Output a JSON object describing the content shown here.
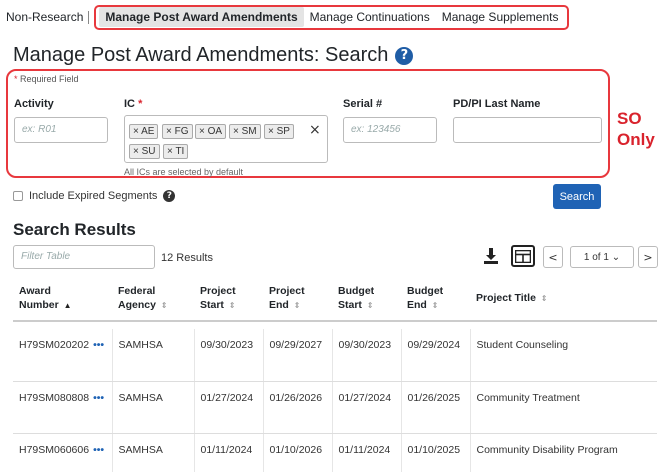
{
  "nav": {
    "non_research": "Non-Research",
    "tabs": [
      {
        "label": "Manage Post Award Amendments",
        "active": true
      },
      {
        "label": "Manage Continuations",
        "active": false
      },
      {
        "label": "Manage Supplements",
        "active": false
      }
    ]
  },
  "page": {
    "title": "Manage Post Award Amendments: Search",
    "help_icon": "?"
  },
  "form": {
    "required_note": "Required Field",
    "required_star": "*",
    "activity": {
      "label": "Activity",
      "placeholder": "ex: R01"
    },
    "ic": {
      "label": "IC",
      "chips": [
        "× AE",
        "× FG",
        "× OA",
        "× SM",
        "× SP",
        "× SU",
        "× TI"
      ],
      "clear": "×",
      "note": "All ICs are selected by default"
    },
    "serial": {
      "label": "Serial #",
      "placeholder": "ex: 123456"
    },
    "pdpi": {
      "label": "PD/PI Last Name",
      "placeholder": ""
    },
    "so_only": [
      "SO",
      "Only"
    ],
    "include_expired": "Include Expired Segments",
    "search_button": "Search"
  },
  "results": {
    "title": "Search Results",
    "filter_placeholder": "Filter Table",
    "count": "12 Results",
    "pagination": {
      "prev": "<",
      "next": ">",
      "page": "1 of 1 ⌄"
    },
    "columns": [
      {
        "line1": "Award",
        "line2": "Number",
        "sort": "▲",
        "active": true
      },
      {
        "line1": "Federal",
        "line2": "Agency",
        "sort": "⇕",
        "active": false
      },
      {
        "line1": "Project",
        "line2": "Start",
        "sort": "⇕",
        "active": false
      },
      {
        "line1": "Project",
        "line2": "End",
        "sort": "⇕",
        "active": false
      },
      {
        "line1": "Budget",
        "line2": "Start",
        "sort": "⇕",
        "active": false
      },
      {
        "line1": "Budget",
        "line2": "End",
        "sort": "⇕",
        "active": false
      },
      {
        "line1": "Project Title",
        "line2": "",
        "sort": "⇕",
        "active": false
      }
    ],
    "rows": [
      {
        "award": "H79SM020202",
        "agency": "SAMHSA",
        "pstart": "09/30/2023",
        "pend": "09/29/2027",
        "bstart": "09/30/2023",
        "bend": "09/29/2024",
        "title": "Student Counseling"
      },
      {
        "award": "H79SM080808",
        "agency": "SAMHSA",
        "pstart": "01/27/2024",
        "pend": "01/26/2026",
        "bstart": "01/27/2024",
        "bend": "01/26/2025",
        "title": "Community Treatment"
      },
      {
        "award": "H79SM060606",
        "agency": "SAMHSA",
        "pstart": "01/11/2024",
        "pend": "01/10/2026",
        "bstart": "01/11/2024",
        "bend": "01/10/2025",
        "title": "Community Disability Program"
      }
    ],
    "row_menu": "•••"
  }
}
